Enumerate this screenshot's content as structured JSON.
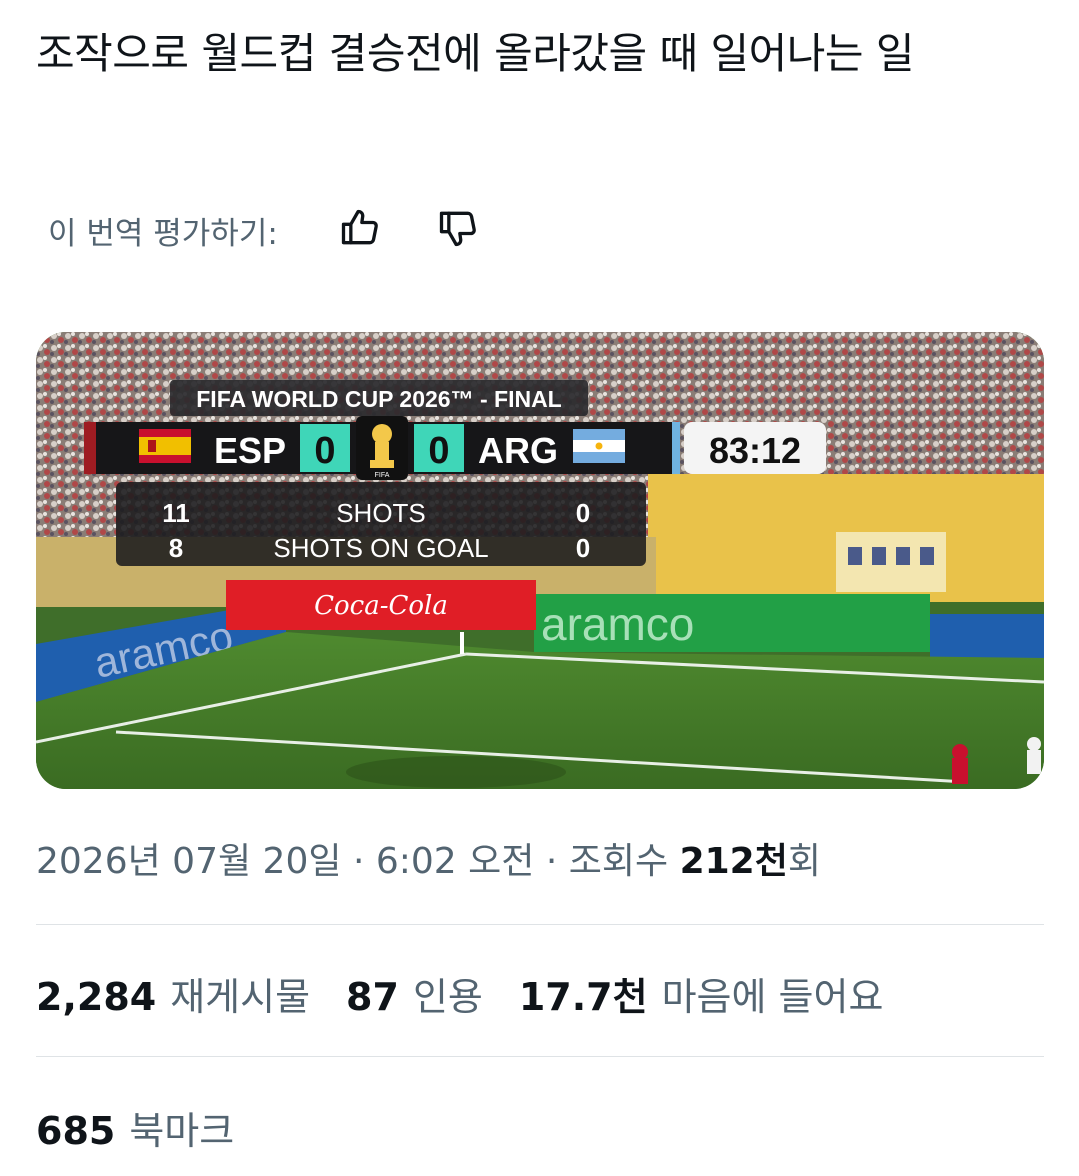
{
  "post": {
    "title": "조작으로 월드컵 결승전에 올라갔을 때 일어나는 일",
    "rate_label": "이 번역 평가하기:",
    "thumbs_up_icon": "thumbs-up-icon",
    "thumbs_down_icon": "thumbs-down-icon"
  },
  "scoreboard": {
    "header": "FIFA WORLD CUP 2026™ - FINAL",
    "home_code": "ESP",
    "home_score": "0",
    "away_score": "0",
    "away_code": "ARG",
    "clock": "83:12",
    "trophy_badge": "FIFA",
    "stats": [
      {
        "home": "11",
        "label": "SHOTS",
        "away": "0"
      },
      {
        "home": "8",
        "label": "SHOTS ON GOAL",
        "away": "0"
      }
    ]
  },
  "ads": {
    "coke": "Coca-Cola",
    "aramco": "aramco"
  },
  "meta": {
    "date": "2026년 07월 20일",
    "time": "6:02 오전",
    "views_prefix": "조회수",
    "views_value": "212천",
    "views_suffix": "회",
    "sep": "·"
  },
  "stats": {
    "retweets_num": "2,284",
    "retweets_label": "재게시물",
    "quotes_num": "87",
    "quotes_label": "인용",
    "likes_num": "17.7천",
    "likes_label": "마음에 들어요",
    "bookmarks_num": "685",
    "bookmarks_label": "북마크"
  },
  "colors": {
    "text": "#0f1419",
    "secondary": "#536471",
    "divider": "#dfe3e6",
    "score_teal": "#3fd6b8",
    "coke_red": "#e01e26",
    "aramco_green": "#22a046",
    "aramco_blue": "#1f5fae"
  }
}
